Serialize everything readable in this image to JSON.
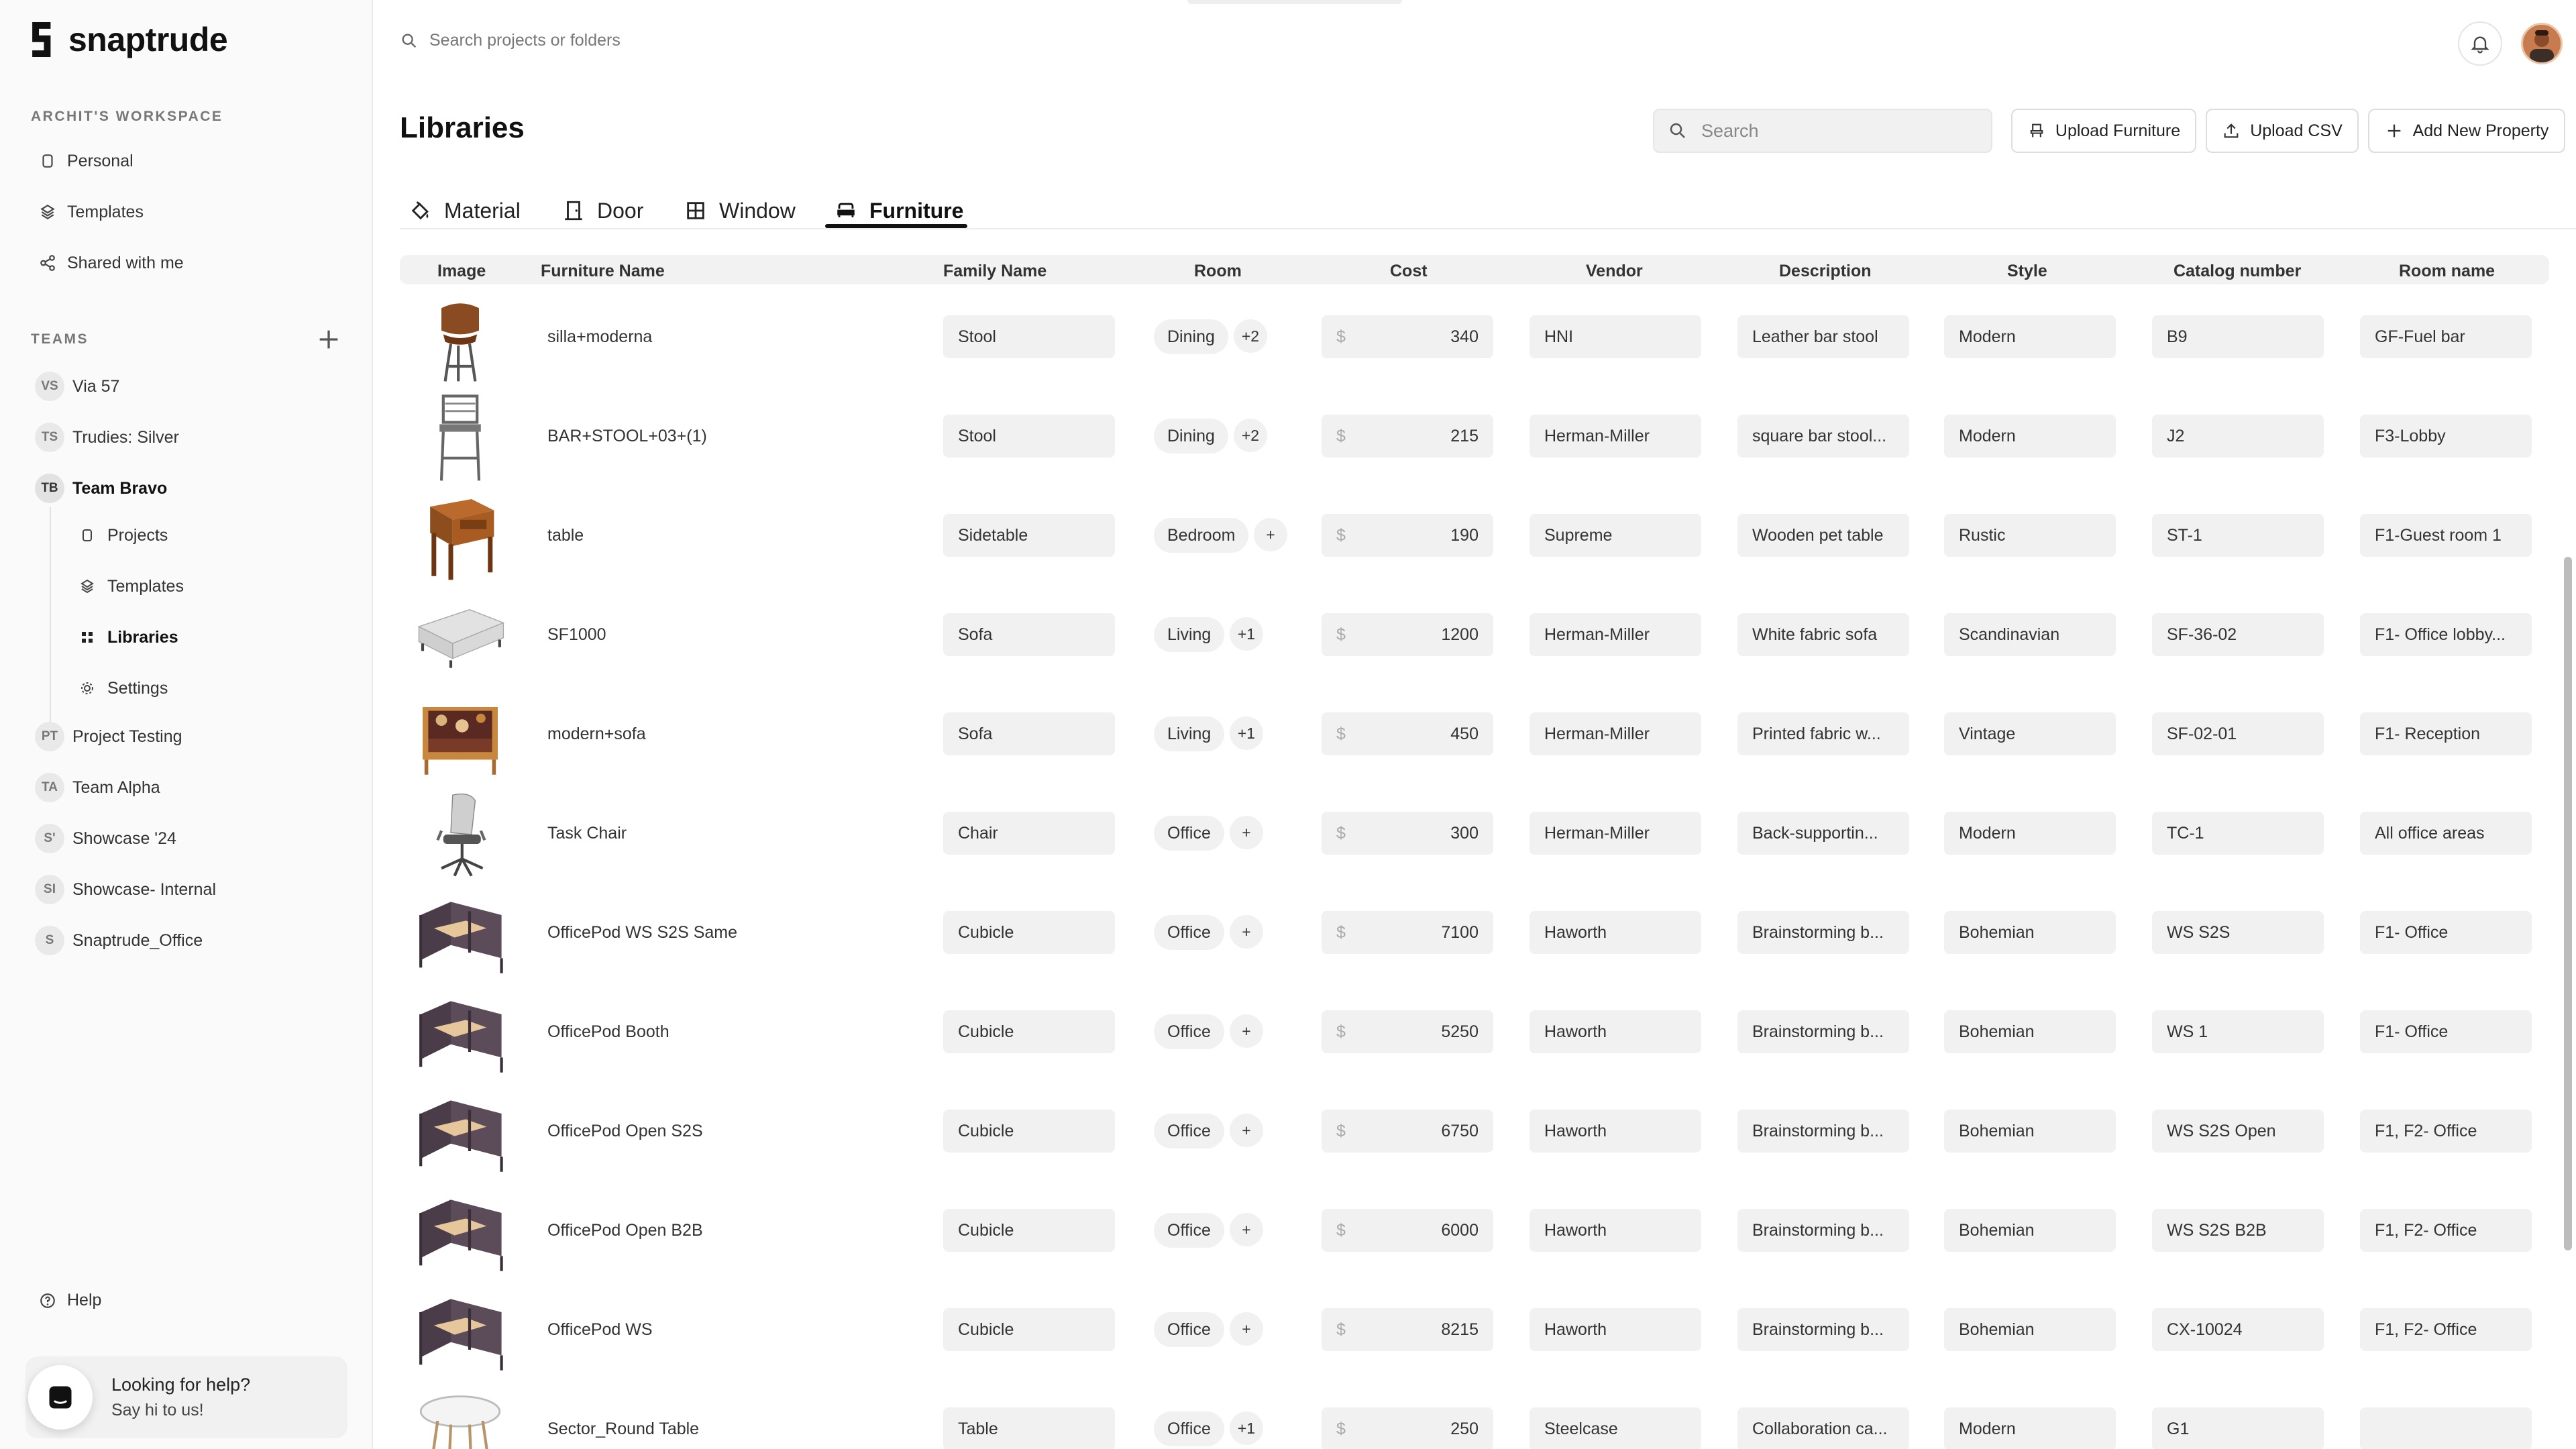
{
  "brand": {
    "name": "snaptrude"
  },
  "sidebar": {
    "workspace_label": "ARCHIT'S WORKSPACE",
    "workspace_items": [
      {
        "label": "Personal",
        "icon": "personal-icon"
      },
      {
        "label": "Templates",
        "icon": "templates-icon"
      },
      {
        "label": "Shared with me",
        "icon": "share-icon"
      }
    ],
    "teams_label": "TEAMS",
    "teams": [
      {
        "badge": "VS",
        "label": "Via 57"
      },
      {
        "badge": "TS",
        "label": "Trudies: Silver"
      },
      {
        "badge": "TB",
        "label": "Team Bravo"
      },
      {
        "badge": "PT",
        "label": "Project Testing"
      },
      {
        "badge": "TA",
        "label": "Team Alpha"
      },
      {
        "badge": "S'",
        "label": "Showcase '24"
      },
      {
        "badge": "SI",
        "label": "Showcase- Internal"
      },
      {
        "badge": "S",
        "label": "Snaptrude_Office"
      }
    ],
    "team_subitems": [
      {
        "label": "Projects",
        "icon": "projects-icon"
      },
      {
        "label": "Templates",
        "icon": "templates-icon"
      },
      {
        "label": "Libraries",
        "icon": "libraries-icon"
      },
      {
        "label": "Settings",
        "icon": "settings-icon"
      }
    ],
    "help_label": "Help",
    "chat": {
      "title": "Looking for help?",
      "subtitle": "Say hi to us!"
    }
  },
  "topbar": {
    "search_placeholder": "Search projects or folders"
  },
  "page": {
    "title": "Libraries",
    "search_placeholder": "Search",
    "buttons": {
      "upload_furniture": "Upload Furniture",
      "upload_csv": "Upload CSV",
      "add_property": "Add New Property"
    }
  },
  "tabs": [
    {
      "label": "Material",
      "icon": "paint-bucket-icon"
    },
    {
      "label": "Door",
      "icon": "door-icon"
    },
    {
      "label": "Window",
      "icon": "window-icon"
    },
    {
      "label": "Furniture",
      "icon": "sofa-icon",
      "active": true
    }
  ],
  "table": {
    "columns": [
      "Image",
      "Furniture Name",
      "Family Name",
      "Room",
      "Cost",
      "Vendor",
      "Description",
      "Style",
      "Catalog number",
      "Room name"
    ],
    "currency": "$",
    "rows": [
      {
        "name": "silla+moderna",
        "family": "Stool",
        "room": "Dining",
        "more": "+2",
        "cost": "340",
        "vendor": "HNI",
        "description": "Leather bar stool",
        "style": "Modern",
        "catalog": "B9",
        "room_name": "GF-Fuel bar",
        "thumb": "stool"
      },
      {
        "name": "BAR+STOOL+03+(1)",
        "family": "Stool",
        "room": "Dining",
        "more": "+2",
        "cost": "215",
        "vendor": "Herman-Miller",
        "description": "square bar stool...",
        "style": "Modern",
        "catalog": "J2",
        "room_name": "F3-Lobby",
        "thumb": "barstool"
      },
      {
        "name": "table",
        "family": "Sidetable",
        "room": "Bedroom",
        "more": "+",
        "cost": "190",
        "vendor": "Supreme",
        "description": "Wooden pet table",
        "style": "Rustic",
        "catalog": "ST-1",
        "room_name": "F1-Guest room 1",
        "thumb": "sidetable"
      },
      {
        "name": "SF1000",
        "family": "Sofa",
        "room": "Living",
        "more": "+1",
        "cost": "1200",
        "vendor": "Herman-Miller",
        "description": "White fabric sofa",
        "style": "Scandinavian",
        "catalog": "SF-36-02",
        "room_name": "F1- Office lobby...",
        "thumb": "sofa-white"
      },
      {
        "name": "modern+sofa",
        "family": "Sofa",
        "room": "Living",
        "more": "+1",
        "cost": "450",
        "vendor": "Herman-Miller",
        "description": "Printed fabric w...",
        "style": "Vintage",
        "catalog": "SF-02-01",
        "room_name": "F1- Reception",
        "thumb": "sofa-print"
      },
      {
        "name": "Task Chair",
        "family": "Chair",
        "room": "Office",
        "more": "+",
        "cost": "300",
        "vendor": "Herman-Miller",
        "description": "Back-supportin...",
        "style": "Modern",
        "catalog": "TC-1",
        "room_name": "All office areas",
        "thumb": "taskchair"
      },
      {
        "name": "OfficePod WS S2S Same",
        "family": "Cubicle",
        "room": "Office",
        "more": "+",
        "cost": "7100",
        "vendor": "Haworth",
        "description": "Brainstorming b...",
        "style": "Bohemian",
        "catalog": "WS S2S",
        "room_name": "F1- Office",
        "thumb": "pod"
      },
      {
        "name": "OfficePod Booth",
        "family": "Cubicle",
        "room": "Office",
        "more": "+",
        "cost": "5250",
        "vendor": "Haworth",
        "description": "Brainstorming b...",
        "style": "Bohemian",
        "catalog": "WS 1",
        "room_name": "F1- Office",
        "thumb": "pod"
      },
      {
        "name": "OfficePod Open S2S",
        "family": "Cubicle",
        "room": "Office",
        "more": "+",
        "cost": "6750",
        "vendor": "Haworth",
        "description": "Brainstorming b...",
        "style": "Bohemian",
        "catalog": "WS S2S Open",
        "room_name": "F1, F2- Office",
        "thumb": "pod"
      },
      {
        "name": "OfficePod Open B2B",
        "family": "Cubicle",
        "room": "Office",
        "more": "+",
        "cost": "6000",
        "vendor": "Haworth",
        "description": "Brainstorming b...",
        "style": "Bohemian",
        "catalog": "WS S2S B2B",
        "room_name": "F1, F2- Office",
        "thumb": "pod"
      },
      {
        "name": "OfficePod WS",
        "family": "Cubicle",
        "room": "Office",
        "more": "+",
        "cost": "8215",
        "vendor": "Haworth",
        "description": "Brainstorming b...",
        "style": "Bohemian",
        "catalog": "CX-10024",
        "room_name": "F1, F2- Office",
        "thumb": "pod"
      },
      {
        "name": "Sector_Round Table",
        "family": "Table",
        "room": "Office",
        "more": "+1",
        "cost": "250",
        "vendor": "Steelcase",
        "description": "Collaboration ca...",
        "style": "Modern",
        "catalog": "G1",
        "room_name": "",
        "thumb": "roundtable"
      }
    ]
  }
}
